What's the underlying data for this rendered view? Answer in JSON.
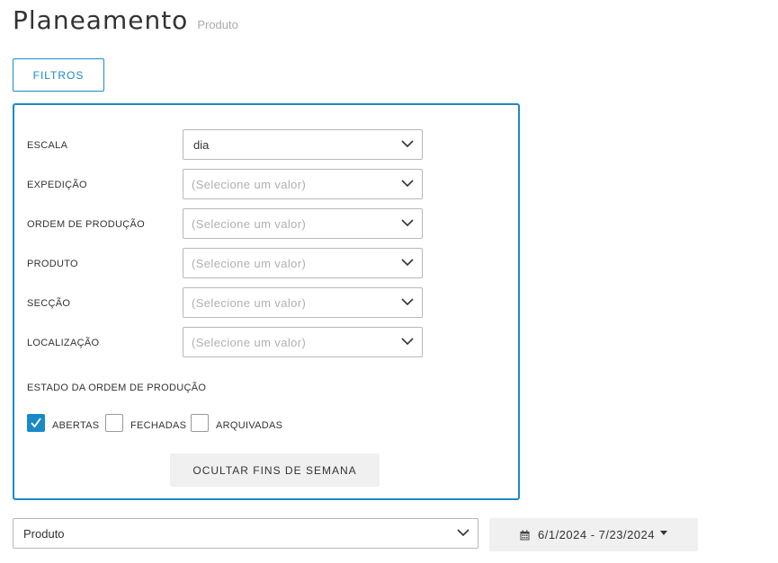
{
  "header": {
    "title": "Planeamento",
    "subtitle": "Produto"
  },
  "filters_button": {
    "label": "FILTROS"
  },
  "filter_panel": {
    "fields": [
      {
        "label": "ESCALA",
        "value": "dia",
        "placeholder": ""
      },
      {
        "label": "EXPEDIÇÃO",
        "value": "",
        "placeholder": "(Selecione um valor)"
      },
      {
        "label": "ORDEM DE PRODUÇÃO",
        "value": "",
        "placeholder": "(Selecione um valor)"
      },
      {
        "label": "PRODUTO",
        "value": "",
        "placeholder": "(Selecione um valor)"
      },
      {
        "label": "SECÇÃO",
        "value": "",
        "placeholder": "(Selecione um valor)"
      },
      {
        "label": "LOCALIZAÇÃO",
        "value": "",
        "placeholder": "(Selecione um valor)"
      }
    ],
    "status_label": "ESTADO DA ORDEM DE PRODUÇÃO",
    "status_options": [
      {
        "label": "ABERTAS",
        "checked": true
      },
      {
        "label": "FECHADAS",
        "checked": false
      },
      {
        "label": "ARQUIVADAS",
        "checked": false
      }
    ],
    "weekend_button_label": "OCULTAR FINS DE SEMANA"
  },
  "view_select": {
    "value": "Produto"
  },
  "date_range": {
    "label": "6/1/2024 - 7/23/2024",
    "icon": "calendar-icon"
  },
  "colors": {
    "accent": "#1a8ac6",
    "border": "#b8b8b8",
    "button_bg": "#f0f0f0",
    "placeholder": "#b0b0b0"
  }
}
